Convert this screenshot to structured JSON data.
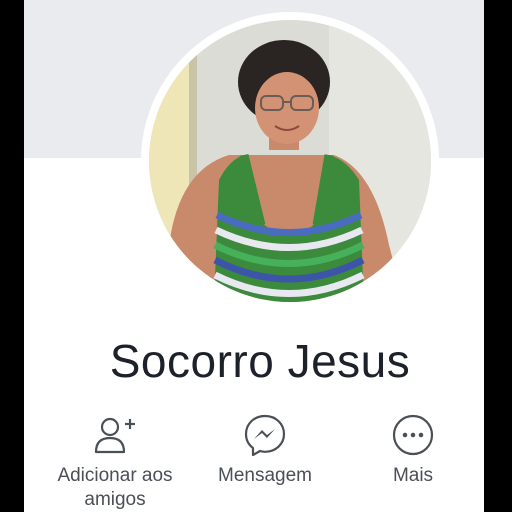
{
  "profile": {
    "name": "Socorro Jesus"
  },
  "actions": [
    {
      "label": "Adicionar aos amigos",
      "icon": "add-friend-icon"
    },
    {
      "label": "Mensagem",
      "icon": "messenger-icon"
    },
    {
      "label": "Mais",
      "icon": "more-icon"
    }
  ],
  "colors": {
    "cover": "#e9ebee",
    "text": "#1d2129",
    "icon": "#4b4f56"
  }
}
